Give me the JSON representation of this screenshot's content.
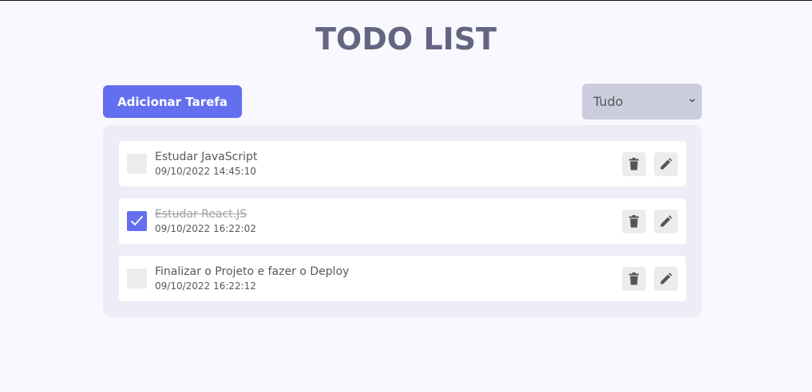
{
  "header": {
    "title": "TODO LIST"
  },
  "toolbar": {
    "add_label": "Adicionar Tarefa",
    "filter_value": "Tudo"
  },
  "todos": [
    {
      "title": "Estudar JavaScript",
      "time": "09/10/2022 14:45:10",
      "completed": false
    },
    {
      "title": "Estudar React.JS",
      "time": "09/10/2022 16:22:02",
      "completed": true
    },
    {
      "title": "Finalizar o Projeto e fazer o Deploy",
      "time": "09/10/2022 16:22:12",
      "completed": false
    }
  ],
  "icons": {
    "delete": "trash-icon",
    "edit": "pencil-icon",
    "check": "check-icon",
    "dropdown": "chevron-down-icon"
  },
  "colors": {
    "accent": "#646ff0",
    "title": "#646681",
    "filter_bg": "#cccdde",
    "list_bg": "#ecedf6"
  }
}
